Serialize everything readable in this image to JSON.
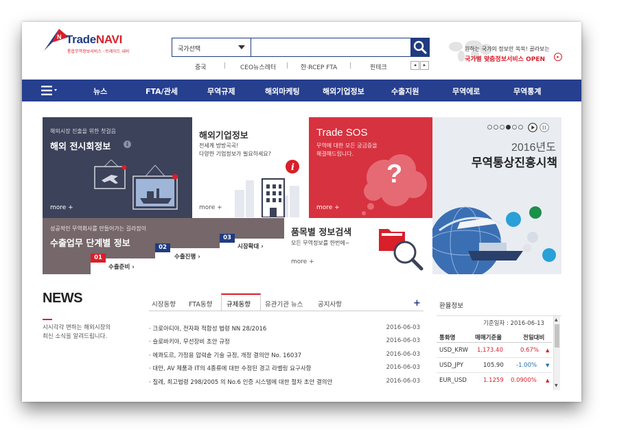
{
  "header": {
    "logo": {
      "brand_part1": "Trade",
      "brand_part2": "NAVI",
      "tagline": "통합무역정보서비스 · 트레이드 내비"
    },
    "search": {
      "select_label": "국가선택",
      "value": ""
    },
    "keywords": [
      "중국",
      "CEO뉴스레터",
      "한·RCEP FTA",
      "핀테크"
    ],
    "promo": {
      "line1": "원하는 국가의 정보만 쏙쏙! 골라보는",
      "line2": "국가별 맞춤정보서비스 OPEN",
      "arrow": "▸"
    },
    "arrows": [
      "◂",
      "▸"
    ]
  },
  "nav": {
    "items": [
      "뉴스",
      "FTA/관세",
      "무역규제",
      "해외마케팅",
      "해외기업정보",
      "수출지원",
      "무역에로",
      "무역통계"
    ]
  },
  "tiles": {
    "exhibition": {
      "kicker": "해외시장 진출을 위한 첫걸음",
      "title": "해외 전시회정보",
      "info": "i",
      "more": "more +"
    },
    "company": {
      "title": "해외기업정보",
      "desc1": "전세계 방방곡곡!",
      "desc2": "다양한 기업정보가 필요하세요?",
      "more": "more +",
      "info": "i"
    },
    "sos": {
      "title": "Trade SOS",
      "desc1": "무역에 대한 모든 궁금증을",
      "desc2": "해결해드립니다.",
      "more": "more +",
      "mark": "?"
    },
    "banner": {
      "year": "2016년도",
      "title": "무역통상진흥시책"
    },
    "steps": {
      "kicker": "성공적인 무역회사를 만들어가는 길라잡이",
      "title": "수출업무 단계별 정보",
      "step1_no": "01",
      "step1": "수출준비 ›",
      "step2_no": "02",
      "step2": "수출진행 ›",
      "step3_no": "03",
      "step3": "시장확대 ›"
    },
    "item_search": {
      "title": "품목별 정보검색",
      "desc": "모든 무역정보를 한번에~",
      "more": "more +"
    }
  },
  "news": {
    "title": "NEWS",
    "desc1": "시시각각 변하는 해외시장의",
    "desc2": "최신 소식을 알려드립니다.",
    "tabs": [
      "시장동향",
      "FTA동향",
      "규제동향",
      "유관기관 뉴스",
      "공지사항"
    ],
    "active_tab": "규제동향",
    "add": "+",
    "items": [
      {
        "title": "· 크로아티아, 전자파 적합성 법령 NN 28/2016",
        "date": "2016-06-03"
      },
      {
        "title": "· 슬로바키아, 무선장비 초안 규정",
        "date": "2016-06-03"
      },
      {
        "title": "· 에콰도르, 가정용 압력솥 기술 규정, 개정 결의안 No. 16037",
        "date": "2016-06-03"
      },
      {
        "title": "· 대만, AV 제품과 IT의 4종류에 대한 수정된 경고 라벨링 요구사항",
        "date": "2016-06-03"
      },
      {
        "title": "· 칠레, 최고법령 298/2005 의 No.6 인증 시스템에 대한 절차 초안 결의안",
        "date": "2016-06-03"
      }
    ]
  },
  "exchange": {
    "title": "환율정보",
    "basis": "기준일자 : 2016-06-13",
    "headers": [
      "통화명",
      "매매기준율",
      "전일대비"
    ],
    "rows": [
      {
        "currency": "USD_KRW",
        "rate": "1,173.40",
        "change": "0.67%",
        "dir": "up"
      },
      {
        "currency": "USD_JPY",
        "rate": "105.90",
        "change": "-1.00%",
        "dir": "down"
      },
      {
        "currency": "EUR_USD",
        "rate": "1.1259",
        "change": "0.0900%",
        "dir": "up"
      }
    ]
  },
  "colors": {
    "navy": "#263f8e",
    "red": "#d81f2a",
    "sos_red": "#d7323f",
    "slate": "#3c4259",
    "taupe": "#75676a"
  }
}
